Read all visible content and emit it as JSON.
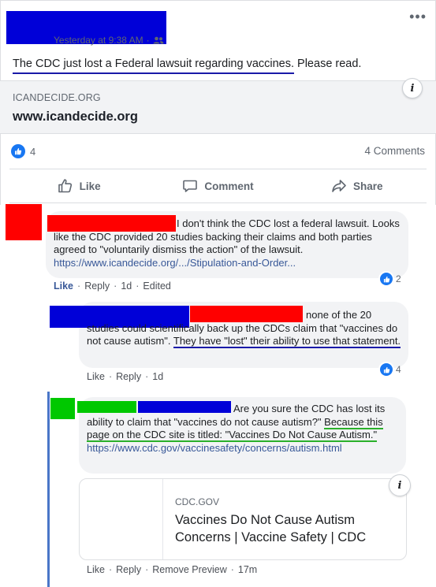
{
  "post": {
    "timestamp": "Yesterday at 9:38 AM",
    "separator": "·",
    "privacy_icon": "friends-icon",
    "more_label": "•••",
    "text_underlined": "The CDC just lost a Federal lawsuit regarding vaccines.",
    "text_rest": " Please read.",
    "link_preview": {
      "domain": "ICANDECIDE.ORG",
      "title": "www.icandecide.org",
      "info_label": "i"
    },
    "reactions_count": "4",
    "comments_count": "4 Comments",
    "actions": {
      "like": "Like",
      "comment": "Comment",
      "share": "Share"
    }
  },
  "comments": [
    {
      "text": " I don't think the CDC lost a federal lawsuit. Looks like the CDC provided 20 studies backing their claims and both parties agreed to \"voluntarily dismiss the action\" of the lawsuit.",
      "link": "https://www.icandecide.org/.../Stipulation-and-Order...",
      "footer": {
        "like": "Like",
        "reply": "Reply",
        "time": "1d",
        "edited": "Edited"
      },
      "reactions": "2"
    },
    {
      "text_start": " none of the 20 studies could scientifically back up the CDCs claim that \"vaccines do not cause autism\". ",
      "text_underlined": "They have \"lost\" their ability to use that statement.",
      "footer": {
        "like": "Like",
        "reply": "Reply",
        "time": "1d"
      },
      "reactions": "4"
    },
    {
      "text_start": " Are you sure the CDC has lost its ability to claim that \"vaccines do not cause autism?\" ",
      "text_underlined": "Because this page on the CDC site is titled: \"Vaccines Do Not Cause Autism.\"",
      "link": "https://www.cdc.gov/vaccinesafety/concerns/autism.html",
      "preview": {
        "domain": "CDC.GOV",
        "title": "Vaccines Do Not Cause Autism Concerns | Vaccine Safety | CDC",
        "info_label": "i"
      },
      "footer": {
        "like": "Like",
        "reply": "Reply",
        "remove_preview": "Remove Preview",
        "time": "17m"
      }
    }
  ],
  "separator_dot": "·",
  "colors": {
    "redact_blue": "#0000d8",
    "redact_red": "#ff0000",
    "redact_green": "#00c800",
    "facebook_blue": "#1877f2",
    "link_blue": "#385898"
  }
}
